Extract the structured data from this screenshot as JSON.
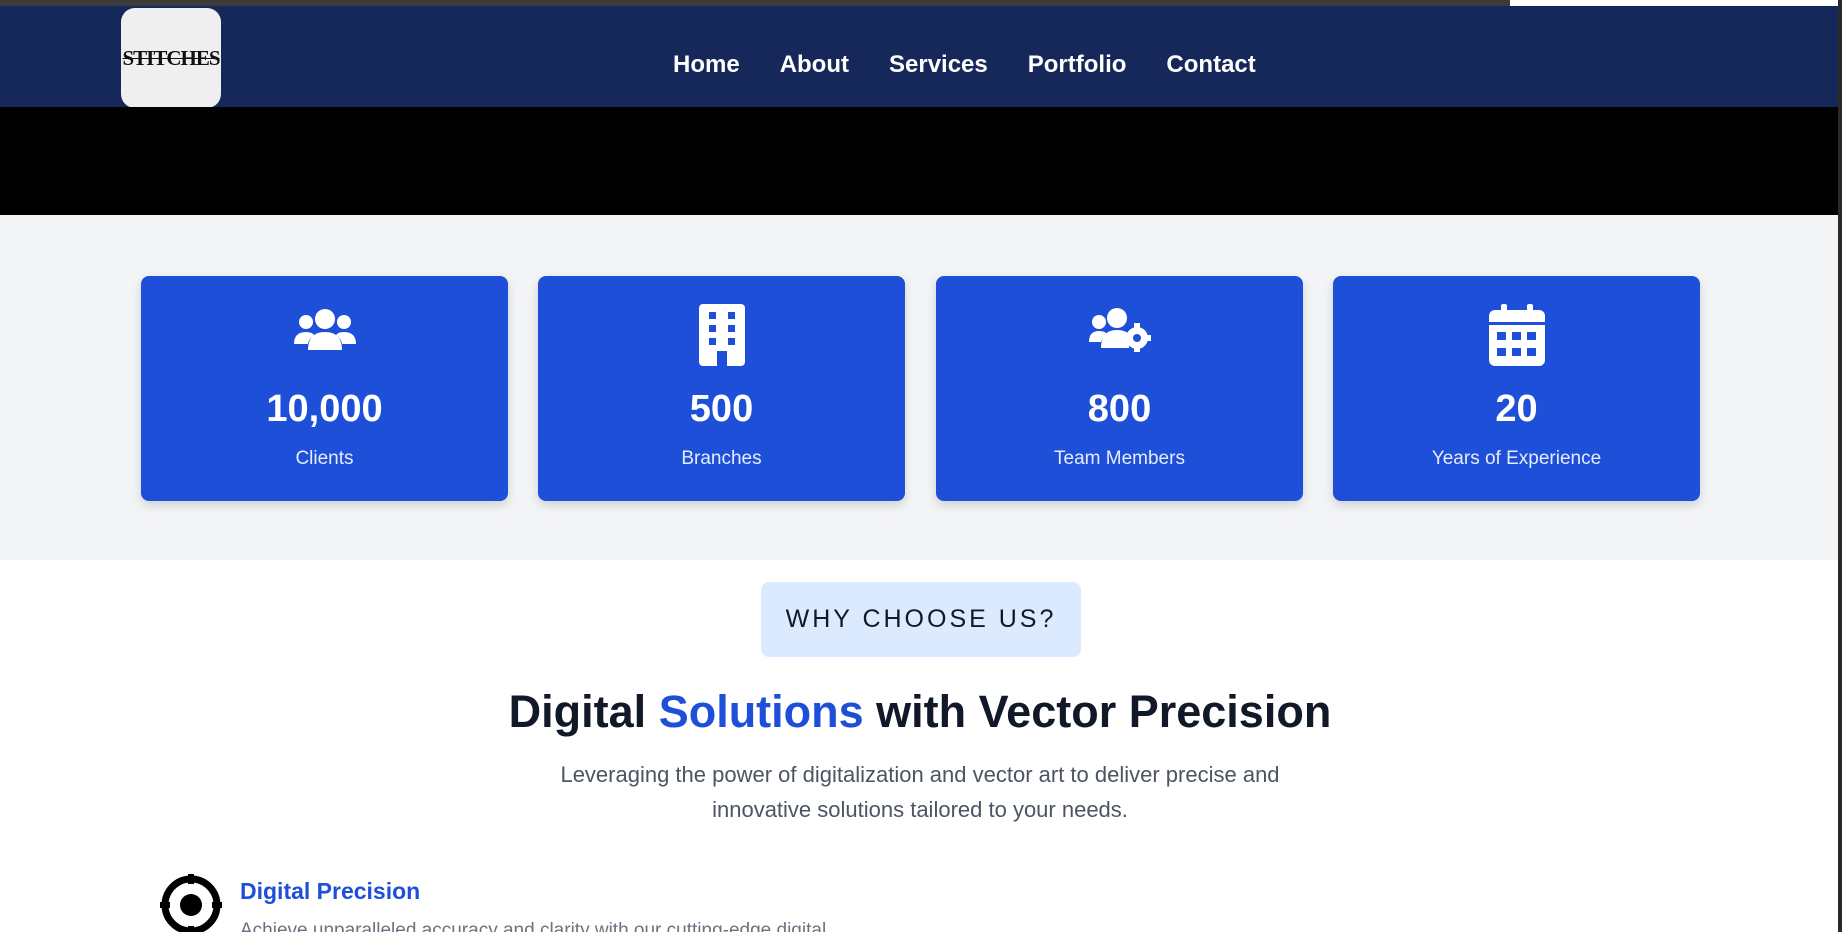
{
  "brand": {
    "logo_text": "STITCHES"
  },
  "nav": {
    "items": [
      {
        "label": "Home"
      },
      {
        "label": "About"
      },
      {
        "label": "Services"
      },
      {
        "label": "Portfolio"
      },
      {
        "label": "Contact"
      }
    ]
  },
  "stats": [
    {
      "icon": "users-icon",
      "value": "10,000",
      "label": "Clients"
    },
    {
      "icon": "building-icon",
      "value": "500",
      "label": "Branches"
    },
    {
      "icon": "users-gear-icon",
      "value": "800",
      "label": "Team Members"
    },
    {
      "icon": "calendar-icon",
      "value": "20",
      "label": "Years of Experience"
    }
  ],
  "why": {
    "badge": "WHY CHOOSE US?",
    "headline_pre": "Digital ",
    "headline_accent": "Solutions",
    "headline_post": " with Vector Precision",
    "subtext": "Leveraging the power of digitalization and vector art to deliver precise and innovative solutions tailored to your needs."
  },
  "features": [
    {
      "icon": "target-icon",
      "title": "Digital Precision",
      "text": "Achieve unparalleled accuracy and clarity with our cutting-edge digital"
    }
  ],
  "colors": {
    "navbar": "#16275a",
    "accent": "#1e4fd8",
    "stats_bg": "#f3f4f6",
    "badge_bg": "#dbeafe"
  }
}
